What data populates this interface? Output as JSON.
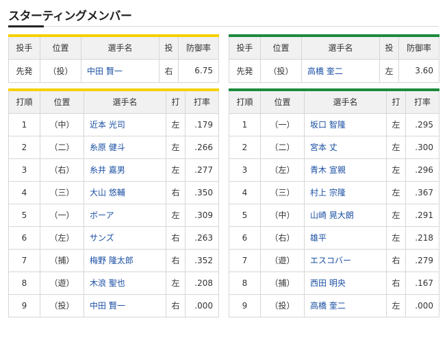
{
  "title": "スターティングメンバー",
  "pitcher_headers": [
    "投手",
    "位置",
    "選手名",
    "投",
    "防御率"
  ],
  "order_headers": [
    "打順",
    "位置",
    "選手名",
    "打",
    "打率"
  ],
  "colors": {
    "tigers_accent": "#f5d000",
    "swallows_accent": "#1c8a3b",
    "link": "#1a4fa3"
  },
  "left_team": {
    "pitcher": {
      "role": "先発",
      "pos": "（投）",
      "name": "中田 賢一",
      "hand": "右",
      "era": "6.75"
    },
    "lineup": [
      {
        "order": "1",
        "pos": "（中）",
        "name": "近本 光司",
        "hand": "左",
        "avg": ".179"
      },
      {
        "order": "2",
        "pos": "（二）",
        "name": "糸原 健斗",
        "hand": "左",
        "avg": ".266"
      },
      {
        "order": "3",
        "pos": "（右）",
        "name": "糸井 嘉男",
        "hand": "左",
        "avg": ".277"
      },
      {
        "order": "4",
        "pos": "（三）",
        "name": "大山 悠輔",
        "hand": "右",
        "avg": ".350"
      },
      {
        "order": "5",
        "pos": "（一）",
        "name": "ボーア",
        "hand": "左",
        "avg": ".309"
      },
      {
        "order": "6",
        "pos": "（左）",
        "name": "サンズ",
        "hand": "右",
        "avg": ".263"
      },
      {
        "order": "7",
        "pos": "（捕）",
        "name": "梅野 隆太郎",
        "hand": "右",
        "avg": ".352"
      },
      {
        "order": "8",
        "pos": "（遊）",
        "name": "木浪 聖也",
        "hand": "左",
        "avg": ".208"
      },
      {
        "order": "9",
        "pos": "（投）",
        "name": "中田 賢一",
        "hand": "右",
        "avg": ".000"
      }
    ]
  },
  "right_team": {
    "pitcher": {
      "role": "先発",
      "pos": "（投）",
      "name": "高橋 奎二",
      "hand": "左",
      "era": "3.60"
    },
    "lineup": [
      {
        "order": "1",
        "pos": "（一）",
        "name": "坂口 智隆",
        "hand": "左",
        "avg": ".295"
      },
      {
        "order": "2",
        "pos": "（二）",
        "name": "宮本 丈",
        "hand": "左",
        "avg": ".300"
      },
      {
        "order": "3",
        "pos": "（左）",
        "name": "青木 宣親",
        "hand": "左",
        "avg": ".296"
      },
      {
        "order": "4",
        "pos": "（三）",
        "name": "村上 宗隆",
        "hand": "左",
        "avg": ".367"
      },
      {
        "order": "5",
        "pos": "（中）",
        "name": "山崎 晃大朗",
        "hand": "左",
        "avg": ".291"
      },
      {
        "order": "6",
        "pos": "（右）",
        "name": "雄平",
        "hand": "左",
        "avg": ".218"
      },
      {
        "order": "7",
        "pos": "（遊）",
        "name": "エスコバー",
        "hand": "右",
        "avg": ".279"
      },
      {
        "order": "8",
        "pos": "（捕）",
        "name": "西田 明央",
        "hand": "右",
        "avg": ".167"
      },
      {
        "order": "9",
        "pos": "（投）",
        "name": "高橋 奎二",
        "hand": "左",
        "avg": ".000"
      }
    ]
  }
}
